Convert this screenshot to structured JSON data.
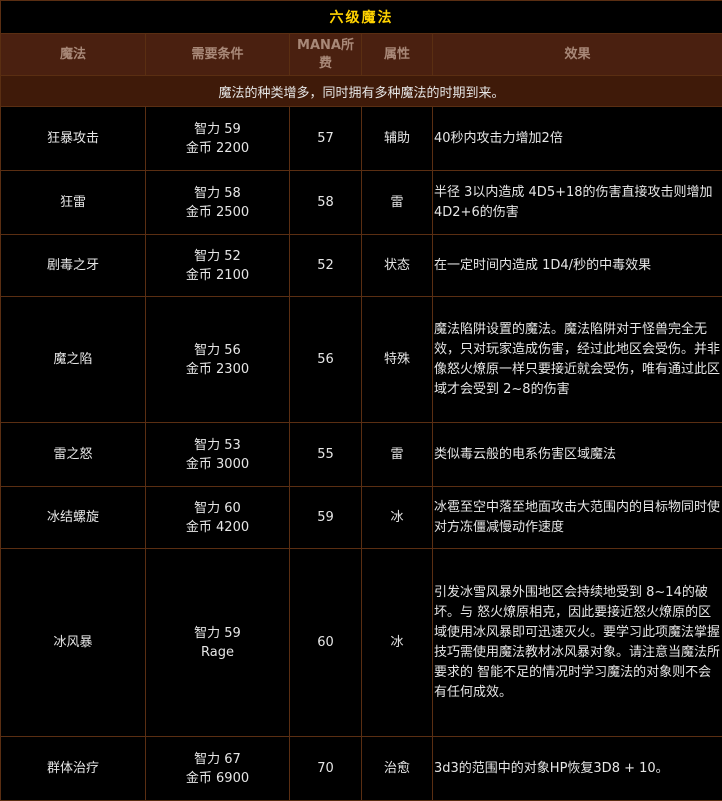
{
  "title": "六级魔法",
  "headers": {
    "name": "魔法",
    "requirement": "需要条件",
    "mana_line1": "MANA所",
    "mana_line2": "费",
    "attribute": "属性",
    "effect": "效果"
  },
  "notice": "魔法的种类增多，同时拥有多种魔法的时期到来。",
  "colors": {
    "title": "#ffd200",
    "header_bg": "#4a2010",
    "border": "#5a2e12"
  },
  "rows": [
    {
      "name": "狂暴攻击",
      "req1": "智力 59",
      "req2": "金币 2200",
      "mana": "57",
      "attr": "辅助",
      "effect": "40秒内攻击力增加2倍"
    },
    {
      "name": "狂雷",
      "req1": "智力 58",
      "req2": "金币 2500",
      "mana": "58",
      "attr": "雷",
      "effect": "半径 3以内造成 4D5+18的伤害直接攻击则增加4D2+6的伤害"
    },
    {
      "name": "剧毒之牙",
      "req1": "智力 52",
      "req2": "金币 2100",
      "mana": "52",
      "attr": "状态",
      "effect": "在一定时间内造成 1D4/秒的中毒效果"
    },
    {
      "name": "魔之陷",
      "req1": "智力 56",
      "req2": "金币 2300",
      "mana": "56",
      "attr": "特殊",
      "effect": "魔法陷阱设置的魔法。魔法陷阱对于怪兽完全无效，只对玩家造成伤害，经过此地区会受伤。并非像怒火燎原一样只要接近就会受伤，唯有通过此区域才会受到 2~8的伤害"
    },
    {
      "name": "雷之怒",
      "req1": "智力 53",
      "req2": "金币 3000",
      "mana": "55",
      "attr": "雷",
      "effect": "类似毒云般的电系伤害区域魔法"
    },
    {
      "name": "冰结螺旋",
      "req1": "智力 60",
      "req2": "金币 4200",
      "mana": "59",
      "attr": "冰",
      "effect": "冰雹至空中落至地面攻击大范围内的目标物同时使对方冻僵减慢动作速度"
    },
    {
      "name": "冰风暴",
      "req1": "智力 59",
      "req2": "Rage",
      "mana": "60",
      "attr": "冰",
      "effect": "引发冰雪风暴外围地区会持续地受到 8~14的破坏。与 怒火燎原相克，因此要接近怒火燎原的区域使用冰风暴即可迅速灭火。要学习此项魔法掌握技巧需使用魔法教材冰风暴对象。请注意当魔法所要求的 智能不足的情况时学习魔法的对象则不会有任何成效。"
    },
    {
      "name": "群体治疗",
      "req1": "智力 67",
      "req2": "金币 6900",
      "mana": "70",
      "attr": "治愈",
      "effect": "3d3的范围中的对象HP恢复3D8 + 10。"
    }
  ]
}
